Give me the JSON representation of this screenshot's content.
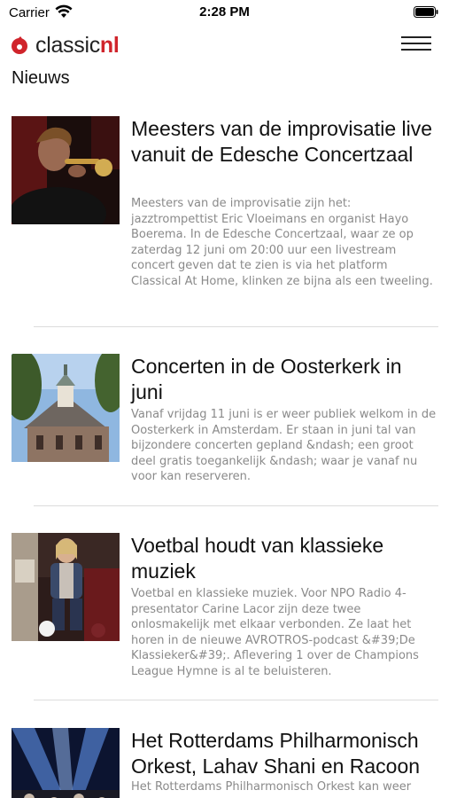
{
  "status_bar": {
    "carrier": "Carrier",
    "time": "2:28 PM"
  },
  "header": {
    "logo_text_main": "classic",
    "logo_text_accent": "nl",
    "brand_color": "#d0242b",
    "menu_icon": "hamburger-menu-icon"
  },
  "section": {
    "title": "Nieuws"
  },
  "articles": [
    {
      "title": "Meesters van de improvisatie live vanuit de Edesche Concertzaal",
      "summary": "Meesters van de improvisatie zijn het: jazztrompettist Eric Vloeimans en organist Hayo Boerema. In de Edesche Concertzaal, waar ze op zaterdag 12 juni om 20:00 uur een livestream concert geven dat te zien is via het platform Classical At Home, klinken ze bijna als een tweeling."
    },
    {
      "title": "Concerten in de Oosterkerk in juni",
      "summary": "Vanaf vrijdag 11 juni is er weer publiek welkom in de Oosterkerk in Amsterdam. Er staan in juni tal van bijzondere concerten gepland &ndash; een groot deel gratis toegankelijk &ndash; waar je vanaf nu voor kan reserveren."
    },
    {
      "title": "Voetbal houdt van klassieke muziek",
      "summary": "Voetbal en klassieke muziek. Voor NPO Radio 4-presentator Carine Lacor zijn deze twee onlosmakelijk met elkaar verbonden. Ze laat het horen in de nieuwe AVROTROS-podcast &#39;De Klassieker&#39;. Aflevering 1 over de Champions League Hymne is al te beluisteren."
    },
    {
      "title": "Het Rotterdams Philharmonisch Orkest, Lahav Shani en Racoon",
      "summary": "Het Rotterdams Philharmonisch Orkest kan weer"
    }
  ]
}
